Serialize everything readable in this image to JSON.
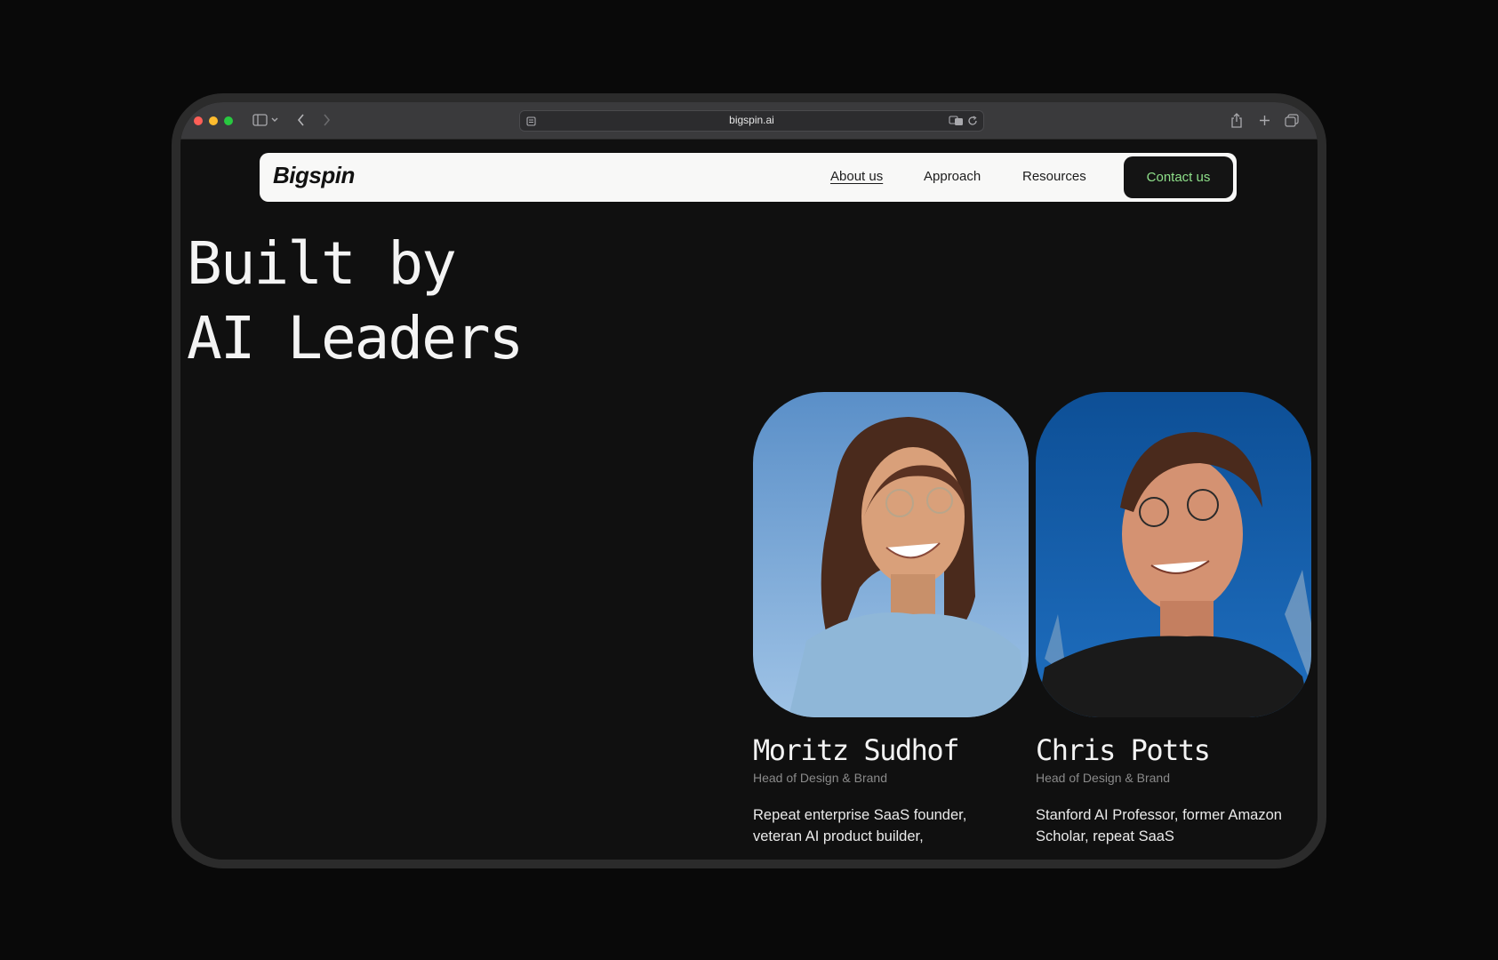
{
  "browser": {
    "url": "bigspin.ai",
    "traffic_lights": {
      "close": "#ff5f57",
      "minimize": "#febc2e",
      "zoom": "#28c840"
    }
  },
  "nav": {
    "logo": "Bigspin",
    "links": [
      "About us",
      "Approach",
      "Resources"
    ],
    "cta": "Contact us"
  },
  "hero": {
    "line1": "Built by",
    "line2": "AI Leaders"
  },
  "team": [
    {
      "name": "Moritz Sudhof",
      "role": "Head of Design & Brand",
      "bio": "Repeat enterprise SaaS founder, veteran AI product builder,"
    },
    {
      "name": "Chris Potts",
      "role": "Head of Design & Brand",
      "bio": "Stanford AI Professor, former Amazon Scholar, repeat SaaS"
    }
  ],
  "colors": {
    "page_bg": "#101010",
    "cta_text": "#8fe08a",
    "navbar_bg": "#f8f8f7"
  }
}
